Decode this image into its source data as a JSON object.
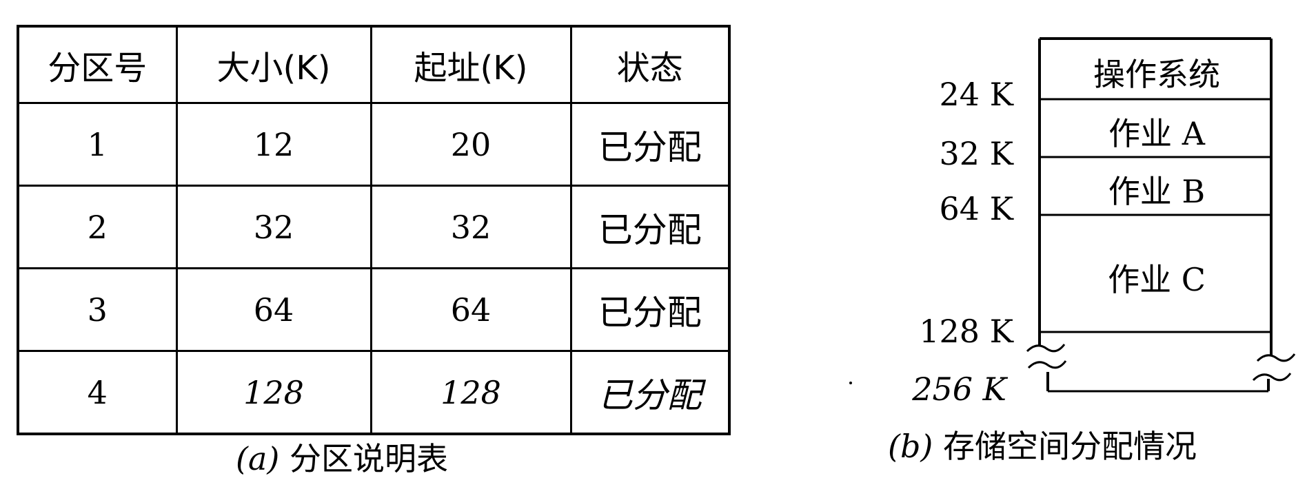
{
  "table": {
    "headers": [
      "分区号",
      "大小(K)",
      "起址(K)",
      "状态"
    ],
    "rows": [
      {
        "id": "1",
        "size": "12",
        "start": "20",
        "status": "已分配"
      },
      {
        "id": "2",
        "size": "32",
        "start": "32",
        "status": "已分配"
      },
      {
        "id": "3",
        "size": "64",
        "start": "64",
        "status": "已分配"
      },
      {
        "id": "4",
        "size": "128",
        "start": "128",
        "status": "已分配"
      }
    ],
    "caption_tag": "(a)",
    "caption_text": "分区说明表"
  },
  "memory": {
    "blocks": [
      {
        "name": "操作系统"
      },
      {
        "name": "作业",
        "suffix": "A"
      },
      {
        "name": "作业",
        "suffix": "B"
      },
      {
        "name": "作业",
        "suffix": "C"
      }
    ],
    "addresses": [
      "24 K",
      "32 K",
      "64 K",
      "128 K",
      "256 K"
    ],
    "caption_tag": "(b)",
    "caption_text": "存储空间分配情况"
  }
}
